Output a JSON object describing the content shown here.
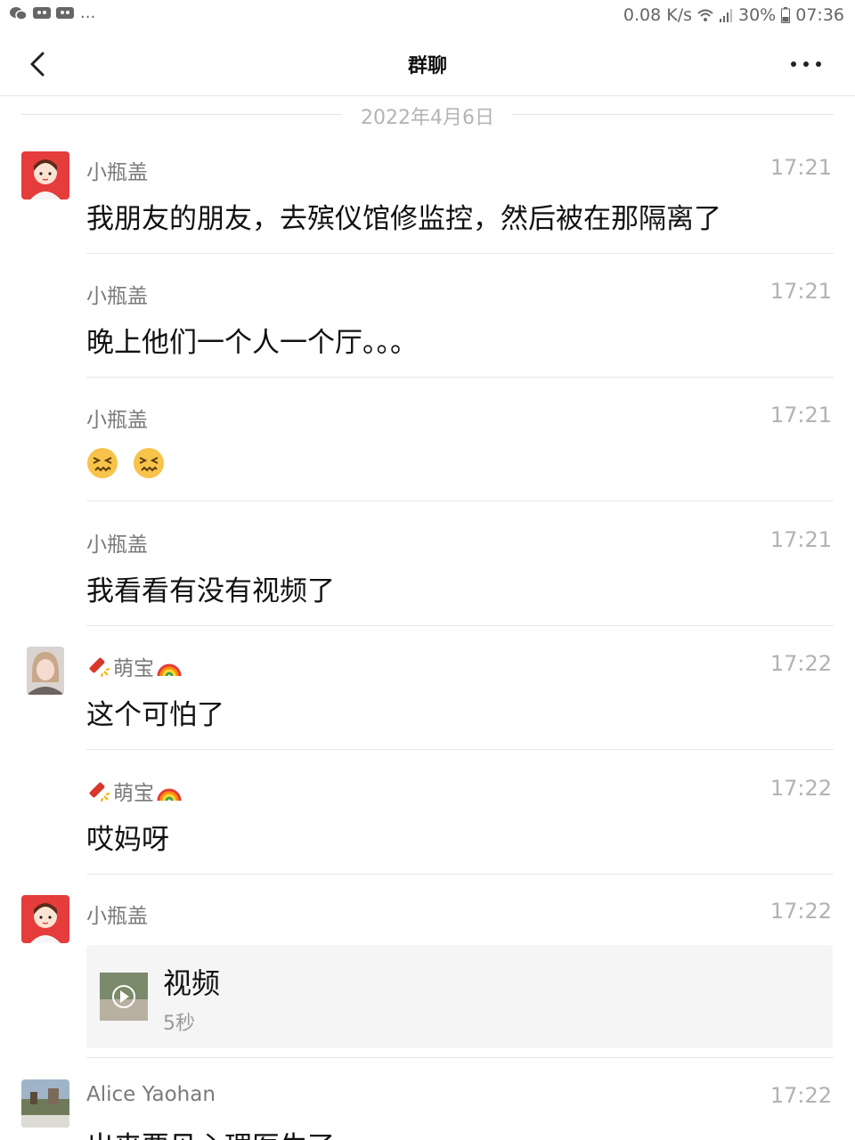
{
  "status_bar": {
    "notification_icons": [
      "wechat-icon",
      "message-icon",
      "message-icon"
    ],
    "more_indicator": "...",
    "network_speed": "0.08 K/s",
    "battery": "30%",
    "time": "07:36"
  },
  "nav": {
    "title": "群聊"
  },
  "date_divider": "2022年4月6日",
  "messages": [
    {
      "sender": "小瓶盖",
      "time": "17:21",
      "text": "我朋友的朋友，去殡仪馆修监控，然后被在那隔离了"
    },
    {
      "sender": "小瓶盖",
      "time": "17:21",
      "text": "晚上他们一个人一个厅。。。"
    },
    {
      "sender": "小瓶盖",
      "time": "17:21",
      "emoji": [
        "confounded-face-icon",
        "confounded-face-icon"
      ]
    },
    {
      "sender": "小瓶盖",
      "time": "17:21",
      "text": "我看看有没有视频了"
    },
    {
      "sender": "萌宝",
      "time": "17:22",
      "text": "这个可怕了"
    },
    {
      "sender": "萌宝",
      "time": "17:22",
      "text": "哎妈呀"
    },
    {
      "sender": "小瓶盖",
      "time": "17:22",
      "video": {
        "title": "视频",
        "duration": "5秒"
      }
    },
    {
      "sender": "Alice Yaohan",
      "time": "17:22",
      "text": "出来要见心理医生了"
    }
  ],
  "colors": {
    "background": "#ffffff",
    "name_gray": "#7a7a7a",
    "time_gray": "#b2b2b2",
    "divider": "#e8e8e8",
    "video_card_bg": "#f5f5f5"
  }
}
